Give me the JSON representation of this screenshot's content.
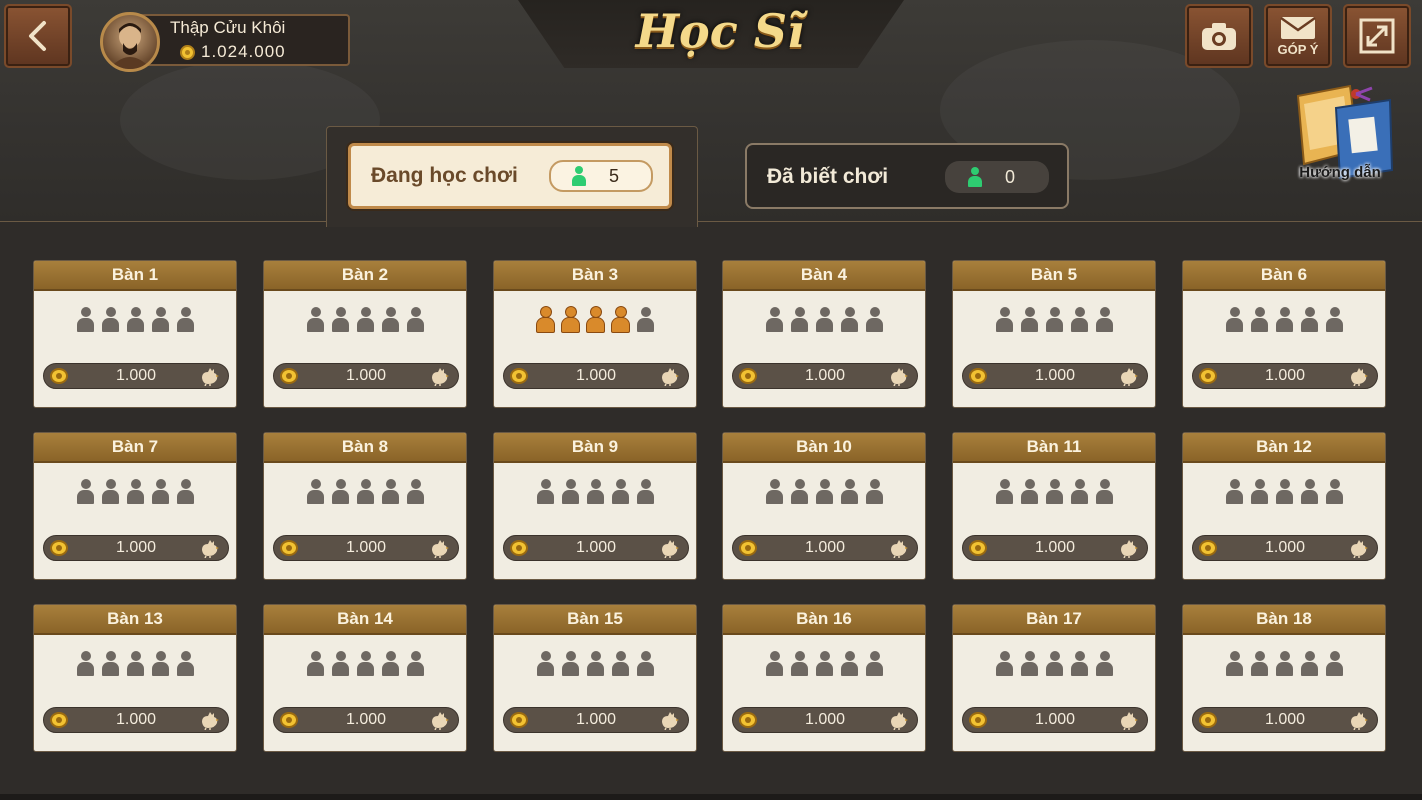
{
  "header": {
    "title": "Học Sĩ",
    "user_name": "Thập Cửu Khôi",
    "user_coins": "1.024.000",
    "feedback_label": "GÓP Ý",
    "guide_label": "Hướng dẫn"
  },
  "tabs": [
    {
      "label": "Đang học chơi",
      "count": "5",
      "active": true
    },
    {
      "label": "Đã biết chơi",
      "count": "0",
      "active": false
    }
  ],
  "tables": [
    {
      "name": "Bàn 1",
      "bet": "1.000",
      "occupied": 0
    },
    {
      "name": "Bàn 2",
      "bet": "1.000",
      "occupied": 0
    },
    {
      "name": "Bàn 3",
      "bet": "1.000",
      "occupied": 4
    },
    {
      "name": "Bàn 4",
      "bet": "1.000",
      "occupied": 0
    },
    {
      "name": "Bàn 5",
      "bet": "1.000",
      "occupied": 0
    },
    {
      "name": "Bàn 6",
      "bet": "1.000",
      "occupied": 0
    },
    {
      "name": "Bàn 7",
      "bet": "1.000",
      "occupied": 0
    },
    {
      "name": "Bàn 8",
      "bet": "1.000",
      "occupied": 0
    },
    {
      "name": "Bàn 9",
      "bet": "1.000",
      "occupied": 0
    },
    {
      "name": "Bàn 10",
      "bet": "1.000",
      "occupied": 0
    },
    {
      "name": "Bàn 11",
      "bet": "1.000",
      "occupied": 0
    },
    {
      "name": "Bàn 12",
      "bet": "1.000",
      "occupied": 0
    },
    {
      "name": "Bàn 13",
      "bet": "1.000",
      "occupied": 0
    },
    {
      "name": "Bàn 14",
      "bet": "1.000",
      "occupied": 0
    },
    {
      "name": "Bàn 15",
      "bet": "1.000",
      "occupied": 0
    },
    {
      "name": "Bàn 16",
      "bet": "1.000",
      "occupied": 0
    },
    {
      "name": "Bàn 17",
      "bet": "1.000",
      "occupied": 0
    },
    {
      "name": "Bàn 18",
      "bet": "1.000",
      "occupied": 0
    }
  ],
  "seats_per_table": 5,
  "colors": {
    "seat_empty": "#6e6862",
    "seat_taken": "#d98a2b",
    "player_icon": "#2ecc71"
  },
  "icons": {
    "back": "chevron-left-icon",
    "camera": "camera-icon",
    "feedback": "envelope-icon",
    "fullscreen": "expand-icon",
    "guide": "book-icon",
    "coin": "coin-icon",
    "rooster": "rooster-icon",
    "seat": "person-icon"
  }
}
